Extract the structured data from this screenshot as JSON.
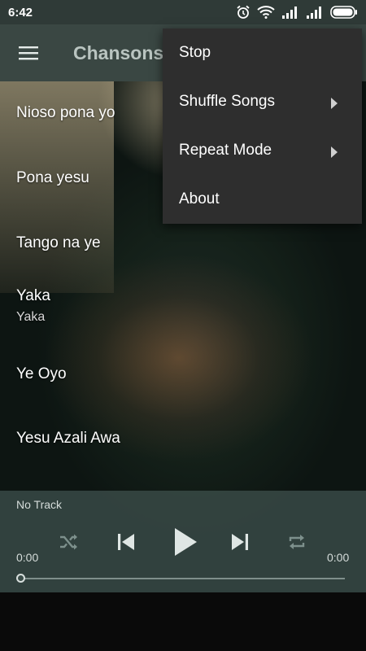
{
  "status_bar": {
    "time": "6:42",
    "icons": [
      "alarm-icon",
      "wifi-icon",
      "signal-icon",
      "signal-icon",
      "battery-icon"
    ]
  },
  "app_bar": {
    "menu_icon": "hamburger-menu-icon",
    "title": "Chansons"
  },
  "songs": [
    {
      "title": "Nioso pona yo"
    },
    {
      "title": "Pona yesu"
    },
    {
      "title": "Tango na ye"
    },
    {
      "title": "Yaka",
      "subtitle": "Yaka"
    },
    {
      "title": "Ye Oyo"
    },
    {
      "title": "Yesu Azali Awa"
    }
  ],
  "player": {
    "track": "No Track",
    "elapsed": "0:00",
    "duration": "0:00",
    "progress": 0,
    "controls": [
      "shuffle-icon",
      "previous-icon",
      "play-icon",
      "next-icon",
      "repeat-icon"
    ]
  },
  "overflow_menu": {
    "items": [
      {
        "label": "Stop",
        "has_submenu": false
      },
      {
        "label": "Shuffle Songs",
        "has_submenu": true
      },
      {
        "label": "Repeat Mode",
        "has_submenu": true
      },
      {
        "label": "About",
        "has_submenu": false
      }
    ]
  },
  "colors": {
    "status_bar": "#2f3a37",
    "app_bar": "#3a4743",
    "title": "#b9c4c0",
    "popup": "#2e2e2e",
    "player_panel": "#3c4e4a"
  }
}
